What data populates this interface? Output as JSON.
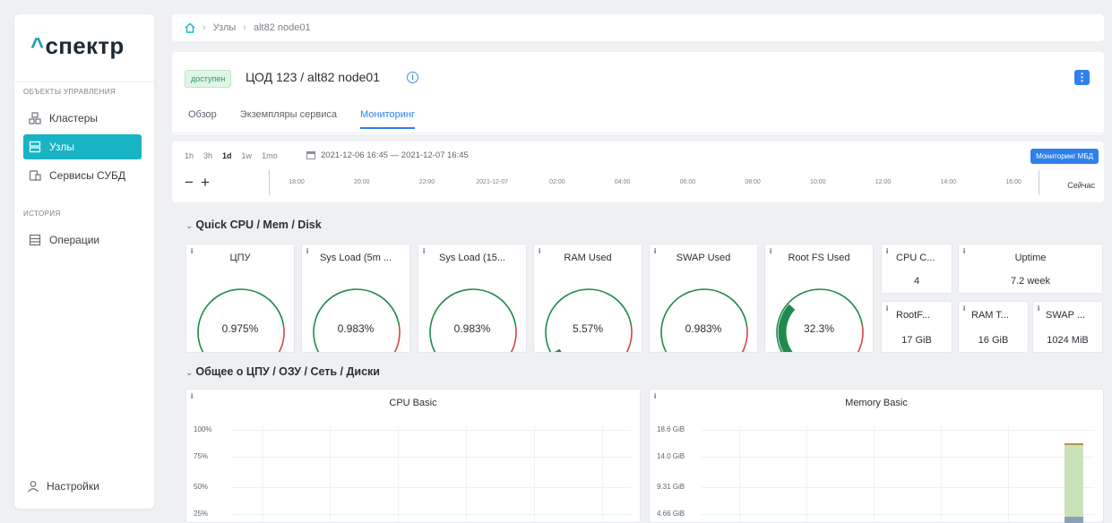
{
  "sidebar": {
    "logo_caret": "^",
    "logo": "спектр",
    "section_objects": "ОБЪЕКТЫ УПРАВЛЕНИЯ",
    "items": [
      {
        "label": "Кластеры",
        "icon": "cluster-icon"
      },
      {
        "label": "Узлы",
        "icon": "server-icon",
        "active": true
      },
      {
        "label": "Сервисы СУБД",
        "icon": "database-icon"
      }
    ],
    "section_history": "ИСТОРИЯ",
    "history_items": [
      {
        "label": "Операции",
        "icon": "operations-icon"
      }
    ],
    "settings": "Настройки"
  },
  "breadcrumb": [
    "Узлы",
    "alt82 node01"
  ],
  "header": {
    "status": "доступен",
    "title": "ЦОД 123 / alt82 node01",
    "info_glyph": "i",
    "menu_glyph": "⋮",
    "tabs": [
      "Обзор",
      "Экземпляры сервиса",
      "Мониторинг"
    ],
    "active_tab": "Мониторинг"
  },
  "time": {
    "ranges": [
      "1h",
      "3h",
      "1d",
      "1w",
      "1mo"
    ],
    "selected_range": "1d",
    "period": "2021-12-06 16:45 — 2021-12-07 16:45",
    "monitor_button": "Мониторинг МБД",
    "zoom_out": "−",
    "zoom_in": "+",
    "ticks": [
      "18:00",
      "20:00",
      "22:00",
      "2021-12-07",
      "02:00",
      "04:00",
      "06:00",
      "08:00",
      "10:00",
      "12:00",
      "14:00",
      "16:00"
    ],
    "now": "Сейчас"
  },
  "section1": {
    "title": "Quick CPU / Mem / Disk",
    "gauges": [
      {
        "title": "ЦПУ",
        "value": "0.975%",
        "percent": 0.975
      },
      {
        "title": "Sys Load (5m ...",
        "value": "0.983%",
        "percent": 0.983
      },
      {
        "title": "Sys Load (15...",
        "value": "0.983%",
        "percent": 0.983
      },
      {
        "title": "RAM Used",
        "value": "5.57%",
        "percent": 5.57
      },
      {
        "title": "SWAP Used",
        "value": "0.983%",
        "percent": 0.983
      },
      {
        "title": "Root FS Used",
        "value": "32.3%",
        "percent": 32.3
      }
    ],
    "stats": [
      {
        "title": "CPU C...",
        "value": "4"
      },
      {
        "title": "Uptime",
        "value": "7.2 week"
      },
      {
        "title": "RootF...",
        "value": "17 GiB"
      },
      {
        "title": "RAM T...",
        "value": "16 GiB"
      },
      {
        "title": "SWAP ...",
        "value": "1024 MiB"
      }
    ]
  },
  "section2": {
    "title": "Общее о ЦПУ / ОЗУ / Сеть / Диски",
    "cpu_basic": {
      "title": "CPU Basic",
      "y_ticks": [
        "100%",
        "75%",
        "50%",
        "25%"
      ]
    },
    "memory_basic": {
      "title": "Memory Basic",
      "y_ticks": [
        "18.6 GiB",
        "14.0 GiB",
        "9.31 GiB",
        "4.66 GiB"
      ]
    }
  },
  "colors": {
    "accent": "#18b4c4",
    "primary": "#2f80ed",
    "gauge_green": "#1f8a4c",
    "gauge_red": "#d64545"
  }
}
